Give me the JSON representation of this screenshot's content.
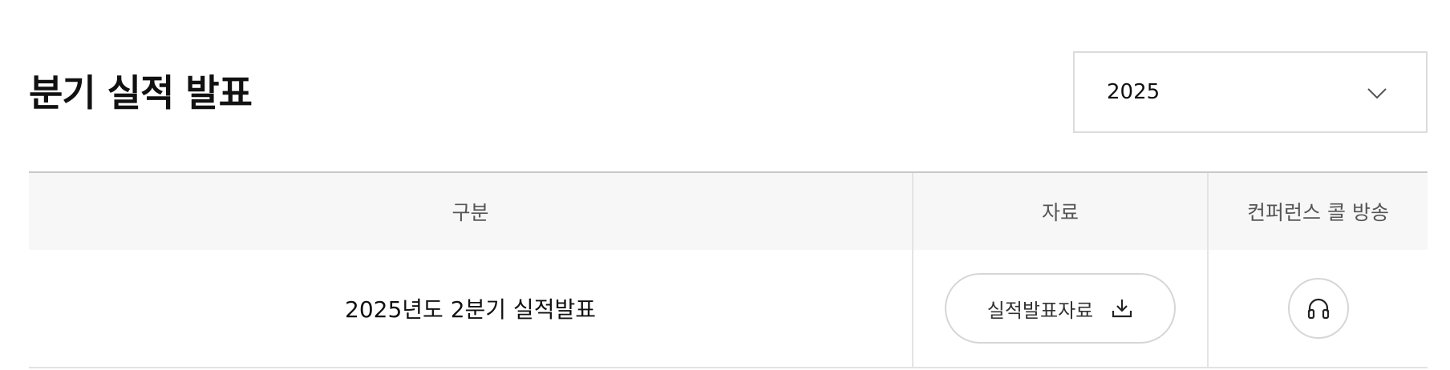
{
  "page": {
    "title": "분기 실적 발표"
  },
  "year_select": {
    "value": "2025",
    "icon": "chevron-down-icon"
  },
  "table": {
    "headers": [
      "구분",
      "자료",
      "컨퍼런스 콜 방송"
    ],
    "rows": [
      {
        "title": "2025년도 2분기 실적발표",
        "material_label": "실적발표자료",
        "material_icon": "download-icon",
        "broadcast_icon": "headphones-icon"
      }
    ]
  },
  "colors": {
    "header_bg": "#f7f7f8",
    "border": "#d6d6d6",
    "text": "#111111",
    "muted_text": "#555555"
  }
}
